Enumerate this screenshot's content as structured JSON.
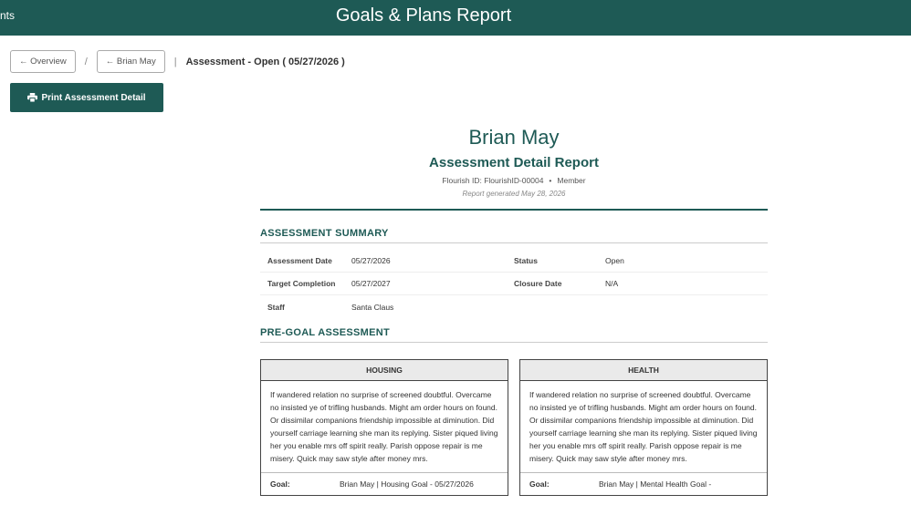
{
  "header": {
    "left_text": "nts",
    "title": "Goals & Plans Report"
  },
  "breadcrumb": {
    "overview_label": "← Overview",
    "separator": "/",
    "member_label": "← Brian May",
    "divider": "|",
    "current": "Assessment - Open ( 05/27/2026 )"
  },
  "toolbar": {
    "print_label": "Print Assessment Detail"
  },
  "report": {
    "member_name": "Brian May",
    "subtitle": "Assessment Detail Report",
    "flourish_id": "Flourish ID: FlourishID-00004",
    "meta_dot": "•",
    "role": "Member",
    "generated": "Report generated May 28, 2026"
  },
  "summary": {
    "title": "ASSESSMENT SUMMARY",
    "assessment_date_label": "Assessment Date",
    "assessment_date": "05/27/2026",
    "status_label": "Status",
    "status": "Open",
    "target_completion_label": "Target Completion",
    "target_completion": "05/27/2027",
    "closure_date_label": "Closure Date",
    "closure_date": "N/A",
    "staff_label": "Staff",
    "staff": "Santa Claus"
  },
  "pre_goal": {
    "title": "PRE-GOAL ASSESSMENT",
    "cards": [
      {
        "heading": "HOUSING",
        "body": "If wandered relation no surprise of screened doubtful. Overcame no insisted ye of trifling husbands. Might am order hours on found. Or dissimilar companions friendship impossible at diminution. Did yourself carriage learning she man its replying. Sister piqued living her you enable mrs off spirit really. Parish oppose repair is me misery. Quick may saw style after money mrs.",
        "goal_label": "Goal:",
        "goal_value": "Brian May | Housing Goal - 05/27/2026"
      },
      {
        "heading": "HEALTH",
        "body": "If wandered relation no surprise of screened doubtful. Overcame no insisted ye of trifling husbands. Might am order hours on found. Or dissimilar companions friendship impossible at diminution. Did yourself carriage learning she man its replying. Sister piqued living her you enable mrs off spirit really. Parish oppose repair is me misery. Quick may saw style after money mrs.",
        "goal_label": "Goal:",
        "goal_value": "Brian May | Mental Health Goal -"
      }
    ]
  },
  "colors": {
    "brand": "#1e5a55",
    "card_header_bg": "#eaeaea"
  },
  "icons": {
    "print": "printer-icon"
  }
}
